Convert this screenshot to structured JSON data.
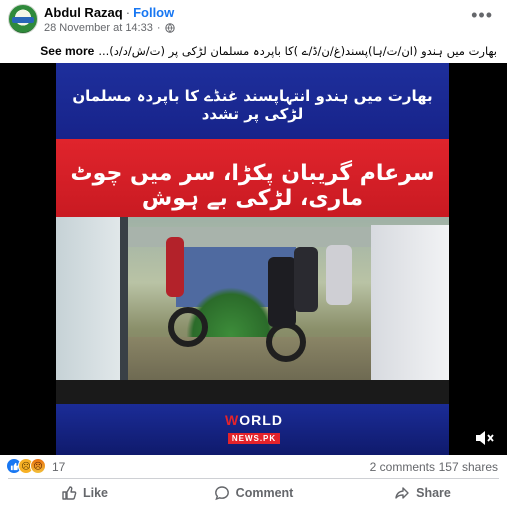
{
  "post": {
    "author": "Abdul Razaq",
    "separator": "·",
    "follow_label": "Follow",
    "timestamp": "28 November at 14:33",
    "separator_meta": "·",
    "more_icon": "more-horizontal-icon",
    "body": "بھارت میں ہندو (ان/ت/ہا)پسند(غ/ن/ڈ/ے )کا باپردہ مسلمان لڑکی پر (ت/ش/د/د)...",
    "see_more_label": "See more"
  },
  "video": {
    "headline_1": "بھارت میں ہندو انتہاپسند غنڈے کا باپردہ مسلمان لڑکی پر تشدد",
    "headline_2": "سرعام گریبان پکڑا، سر میں چوٹ ماری، لڑکی بے ہوش",
    "logo_main_a": "W",
    "logo_main_b": "ORLD",
    "logo_sub": "NEWS.PK",
    "volume_icon": "volume-muted-icon"
  },
  "engagement": {
    "reaction_icons": [
      "like-reaction",
      "sad-reaction",
      "angry-reaction"
    ],
    "reaction_count": "17",
    "comments": "2 comments",
    "shares": "157 shares"
  },
  "actions": {
    "like_label": "Like",
    "comment_label": "Comment",
    "share_label": "Share"
  },
  "colors": {
    "accent": "#1877f2",
    "banner_blue": "#1e2f9c",
    "banner_red": "#e0242c"
  }
}
